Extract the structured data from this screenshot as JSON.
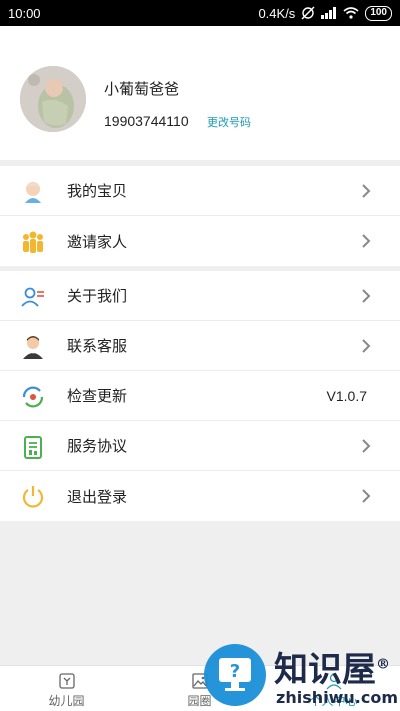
{
  "status_bar": {
    "time": "10:00",
    "network_speed": "0.4K/s",
    "battery": "100",
    "icons": [
      "alarm-off-icon",
      "signal-icon",
      "wifi-icon",
      "battery-icon"
    ]
  },
  "profile": {
    "name": "小葡萄爸爸",
    "phone": "19903744110",
    "change_phone_label": "更改号码"
  },
  "menu_group_1": [
    {
      "label": "我的宝贝",
      "icon": "baby-icon",
      "chevron": true
    },
    {
      "label": "邀请家人",
      "icon": "family-icon",
      "chevron": true
    }
  ],
  "menu_group_2": [
    {
      "label": "关于我们",
      "icon": "about-icon",
      "chevron": true
    },
    {
      "label": "联系客服",
      "icon": "customer-service-icon",
      "chevron": true
    },
    {
      "label": "检查更新",
      "icon": "update-icon",
      "chevron": false,
      "value": "V1.0.7"
    },
    {
      "label": "服务协议",
      "icon": "agreement-icon",
      "chevron": true
    },
    {
      "label": "退出登录",
      "icon": "logout-icon",
      "chevron": true
    }
  ],
  "tabbar": {
    "tabs": [
      {
        "label": "幼儿园",
        "icon": "kindergarten-icon",
        "active": false
      },
      {
        "label": "园圈",
        "icon": "gallery-icon",
        "active": false
      },
      {
        "label": "个人中心",
        "icon": "profile-icon",
        "active": true
      }
    ]
  },
  "watermark": {
    "title": "知识屋",
    "subtitle": "zhishiwu.com",
    "registered_mark": "®"
  },
  "colors": {
    "accent": "#1a9bb8",
    "icon_yellow": "#f2b630",
    "icon_blue": "#3b8fd8",
    "icon_green": "#4caf50",
    "background": "#efefef"
  }
}
